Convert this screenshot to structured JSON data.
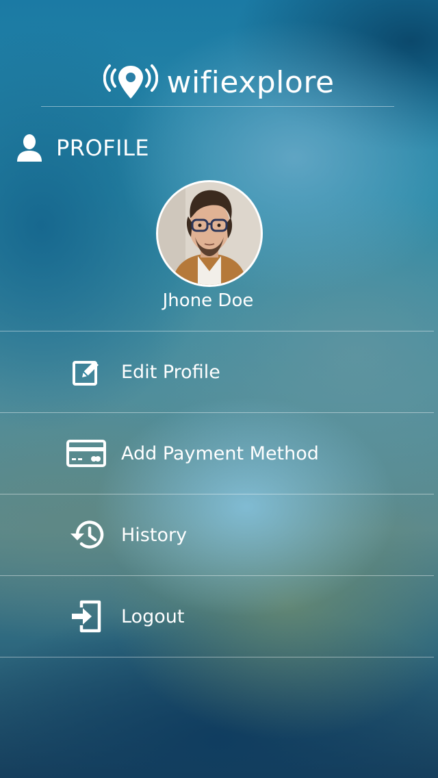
{
  "app": {
    "brand_name": "wifiexplore",
    "brand_icon": "wifi-location-pin-icon"
  },
  "profile_section": {
    "title": "PROFILE",
    "icon": "user-icon",
    "avatar": "profile-photo",
    "user_name": "Jhone Doe"
  },
  "menu": {
    "items": [
      {
        "label": "Edit Profile",
        "icon": "edit-icon"
      },
      {
        "label": "Add Payment Method",
        "icon": "credit-card-icon"
      },
      {
        "label": "History",
        "icon": "history-icon"
      },
      {
        "label": "Logout",
        "icon": "logout-icon"
      }
    ]
  },
  "colors": {
    "text": "#ffffff",
    "background_top": "#1b7aa4",
    "background_bottom": "#173f5c"
  }
}
